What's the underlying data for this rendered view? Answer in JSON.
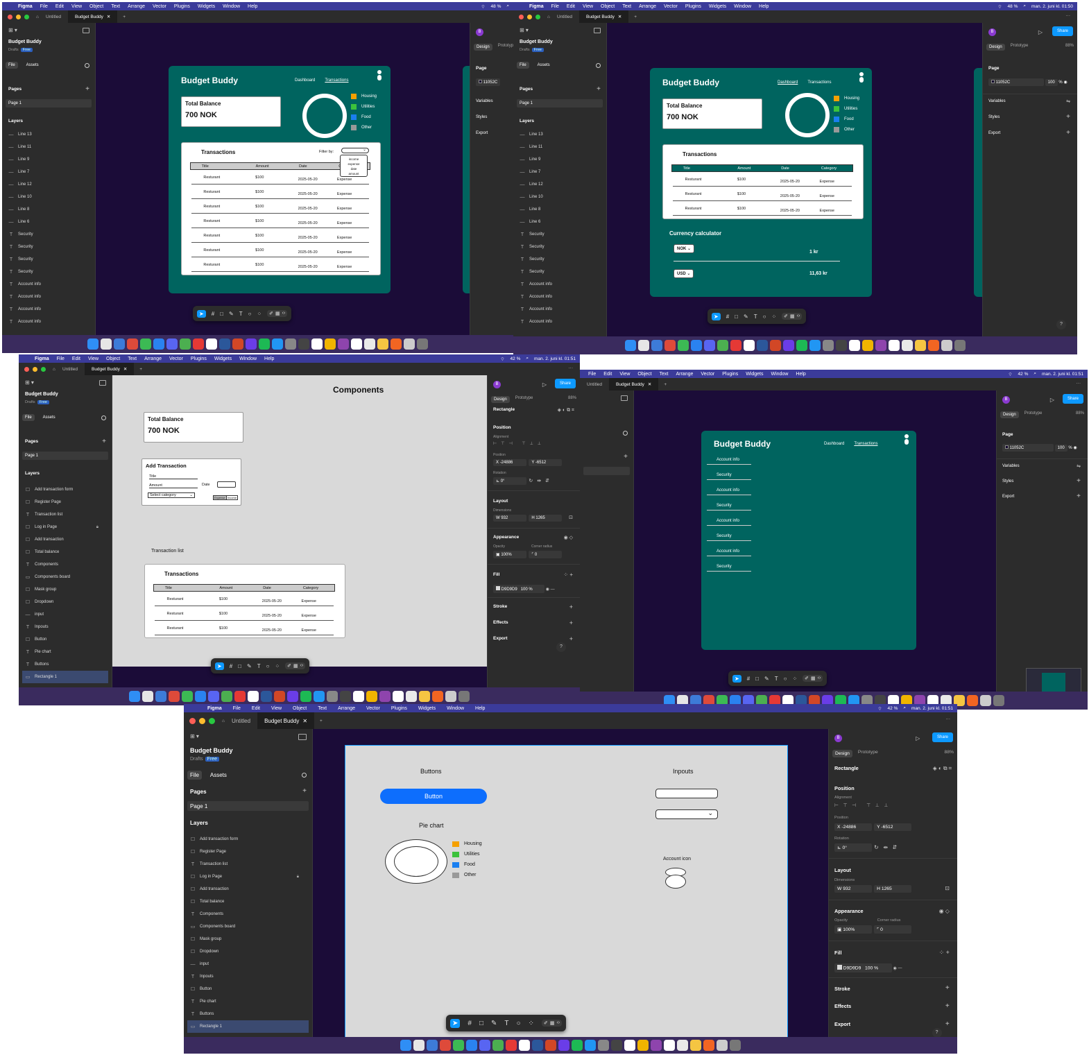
{
  "common": {
    "menubar": {
      "app": "Figma",
      "items": [
        "File",
        "Edit",
        "View",
        "Object",
        "Text",
        "Arrange",
        "Vector",
        "Plugins",
        "Widgets",
        "Window",
        "Help"
      ]
    },
    "tabs": {
      "untitled": "Untitled",
      "budget": "Budget Buddy"
    },
    "project": {
      "name": "Budget Buddy",
      "drafts": "Drafts",
      "free": "Free"
    },
    "panel": {
      "file": "File",
      "assets": "Assets",
      "pages": "Pages",
      "page1": "Page 1",
      "layers": "Layers"
    },
    "design": {
      "design": "Design",
      "prototype": "Prototype",
      "share": "Share",
      "zoom": "88%"
    },
    "layers_a": [
      "Line 13",
      "Line 11",
      "Line 9",
      "Line 7",
      "Line 12",
      "Line 10",
      "Line 8",
      "Line 6",
      "Security",
      "Security",
      "Security",
      "Security",
      "Account info",
      "Account info",
      "Account info",
      "Account info"
    ],
    "layers_b": [
      {
        "name": "Add transaction form",
        "icon": "frame"
      },
      {
        "name": "Register Page",
        "icon": "frame"
      },
      {
        "name": "Transaction list",
        "icon": "text"
      },
      {
        "name": "Log in Page",
        "icon": "frame"
      },
      {
        "name": "Add transaction",
        "icon": "frame"
      },
      {
        "name": "Total balance",
        "icon": "frame"
      },
      {
        "name": "Components",
        "icon": "text"
      },
      {
        "name": "Components board",
        "icon": "rect"
      },
      {
        "name": "Mask group",
        "icon": "frame"
      },
      {
        "name": "Dropdown",
        "icon": "frame"
      },
      {
        "name": "input",
        "icon": "line"
      },
      {
        "name": "Inpouts",
        "icon": "text"
      },
      {
        "name": "Button",
        "icon": "frame"
      },
      {
        "name": "Pie chart",
        "icon": "text"
      },
      {
        "name": "Buttons",
        "icon": "text"
      },
      {
        "name": "Rectangle 1",
        "icon": "rect"
      }
    ],
    "page_panel": {
      "page": "Page",
      "color": "11052C",
      "opacity": "100",
      "pct": "%",
      "variables": "Variables",
      "styles": "Styles",
      "export": "Export"
    },
    "rect_panel": {
      "title": "Rectangle",
      "position": "Position",
      "alignment": "Alignment",
      "pos_label": "Position",
      "x_l": "X",
      "x": "-24886",
      "y_l": "Y",
      "y": "-6512",
      "rotation": "Rotation",
      "rot": "0°",
      "layout": "Layout",
      "dimensions": "Dimensions",
      "w_l": "W",
      "w": "932",
      "h_l": "H",
      "h": "1265",
      "appearance": "Appearance",
      "opacity_l": "Opacity",
      "opacity": "100%",
      "corner_l": "Corner radius",
      "corner": "0",
      "fill": "Fill",
      "fill_color": "D9D9D9",
      "fill_op": "100",
      "pct": "%",
      "stroke": "Stroke",
      "effects": "Effects",
      "export": "Export"
    },
    "status": {
      "battery_48": "48 %",
      "battery_42": "42 %",
      "clock1": "man. 2. juni kl. 01:50",
      "clock2": "man. 2. juni kl. 01:51"
    }
  },
  "app": {
    "title": "Budget Buddy",
    "nav": {
      "dashboard": "Dashboard",
      "transactions": "Transactions"
    },
    "balance": {
      "label": "Total Balance",
      "value": "700 NOK"
    },
    "legend": [
      {
        "label": "Housing",
        "color": "#f5a000"
      },
      {
        "label": "Utilities",
        "color": "#3cc23c"
      },
      {
        "label": "Food",
        "color": "#1a7ff0"
      },
      {
        "label": "Other",
        "color": "#999999"
      }
    ],
    "transactions": {
      "title": "Transactions",
      "filter": "Filter by:",
      "filter_options": [
        "income",
        "expense",
        "date",
        "amount"
      ],
      "columns": [
        "Title",
        "Amount",
        "Date",
        "Category"
      ],
      "row": [
        "Resturant",
        "$100",
        "2025-05-20",
        "Expense"
      ]
    },
    "currency": {
      "title": "Currency calculator",
      "from": "NOK",
      "to": "USD",
      "from_val": "1 kr",
      "to_val": "11,63 kr"
    },
    "account_list": [
      "Account info",
      "Security",
      "Account info",
      "Security",
      "Account info",
      "Security",
      "Account info",
      "Security"
    ]
  },
  "components": {
    "title": "Components",
    "add_tx": {
      "title": "Add Transaction",
      "title_f": "Title",
      "amount_f": "Amount",
      "date_f": "Date",
      "category": "Select category",
      "expense": "Expense",
      "income": "Income"
    },
    "tx_list_label": "Transaction list",
    "buttons": "Buttons",
    "button": "Button",
    "inputs": "Inpouts",
    "pie": "Pie chart",
    "account_icon": "Account icon"
  }
}
